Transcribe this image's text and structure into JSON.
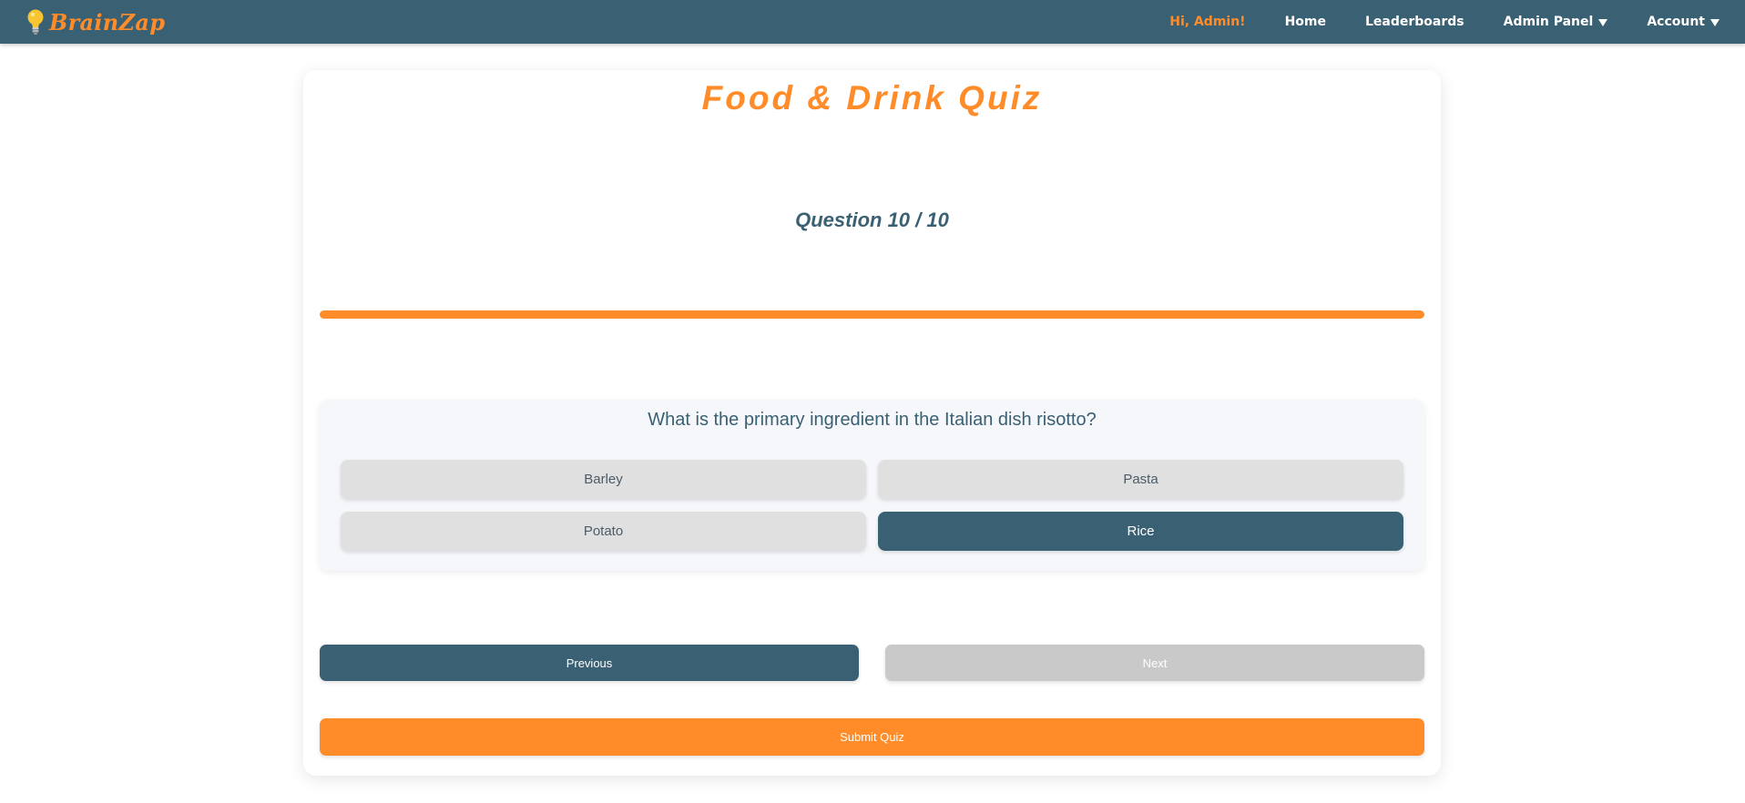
{
  "header": {
    "brand": "BrainZap",
    "greeting": "Hi, Admin!",
    "nav": {
      "home": "Home",
      "leaderboards": "Leaderboards",
      "admin_panel": "Admin Panel",
      "account": "Account"
    }
  },
  "quiz": {
    "title": "Food & Drink Quiz",
    "counter": "Question 10 / 10",
    "progress_fraction": 1.0,
    "question": "What is the primary ingredient in the Italian dish risotto?",
    "options": [
      {
        "label": "Barley",
        "selected": false
      },
      {
        "label": "Pasta",
        "selected": false
      },
      {
        "label": "Potato",
        "selected": false
      },
      {
        "label": "Rice",
        "selected": true
      }
    ],
    "buttons": {
      "previous": "Previous",
      "next": "Next",
      "submit": "Submit Quiz"
    }
  },
  "colors": {
    "navbar": "#3a6073",
    "accent": "#ff8c29",
    "option_default": "#e0e0e0",
    "option_selected": "#3a6073",
    "disabled": "#c9c9c9"
  },
  "icons": {
    "brand": "lightbulb-icon",
    "dropdown": "caret-down-icon"
  }
}
